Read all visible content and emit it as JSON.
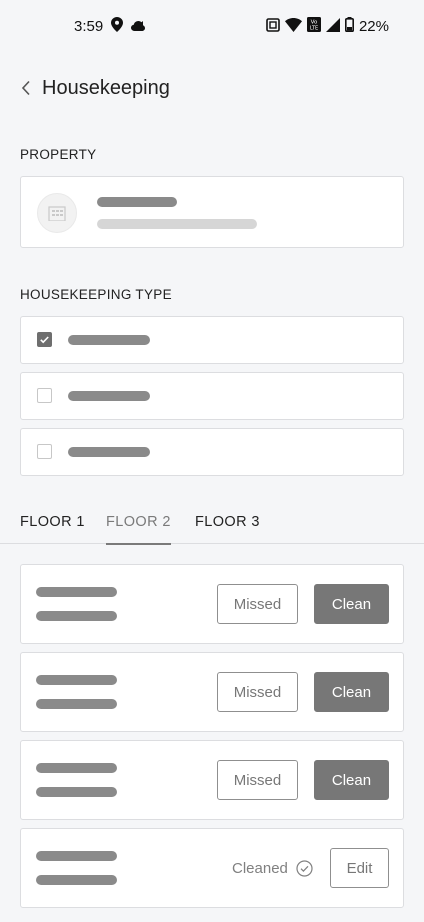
{
  "status_bar": {
    "time": "3:59",
    "battery": "22%",
    "icons_left": [
      "location-pin-icon",
      "cloud-icon"
    ],
    "icons_right": [
      "nfc-icon",
      "wifi-icon",
      "volte-icon",
      "signal-icon",
      "battery-icon"
    ],
    "volte_text": "Vo LTE"
  },
  "header": {
    "title": "Housekeeping",
    "back_icon": "chevron-left-icon"
  },
  "property": {
    "section_label": "PROPERTY",
    "avatar_icon": "building-icon"
  },
  "housekeeping_type": {
    "section_label": "HOUSEKEEPING TYPE",
    "options": [
      {
        "checked": true
      },
      {
        "checked": false
      },
      {
        "checked": false
      }
    ]
  },
  "floors": {
    "tabs": [
      {
        "label": "FLOOR 1",
        "active": false
      },
      {
        "label": "FLOOR 2",
        "active": true
      },
      {
        "label": "FLOOR 3",
        "active": false
      }
    ]
  },
  "rooms": {
    "missed_label": "Missed",
    "clean_label": "Clean",
    "cleaned_label": "Cleaned",
    "edit_label": "Edit",
    "colors": {
      "solid_button": "#777777",
      "outline_border": "#8f8f8f",
      "placeholder_bar": "#8a8a8a"
    }
  }
}
